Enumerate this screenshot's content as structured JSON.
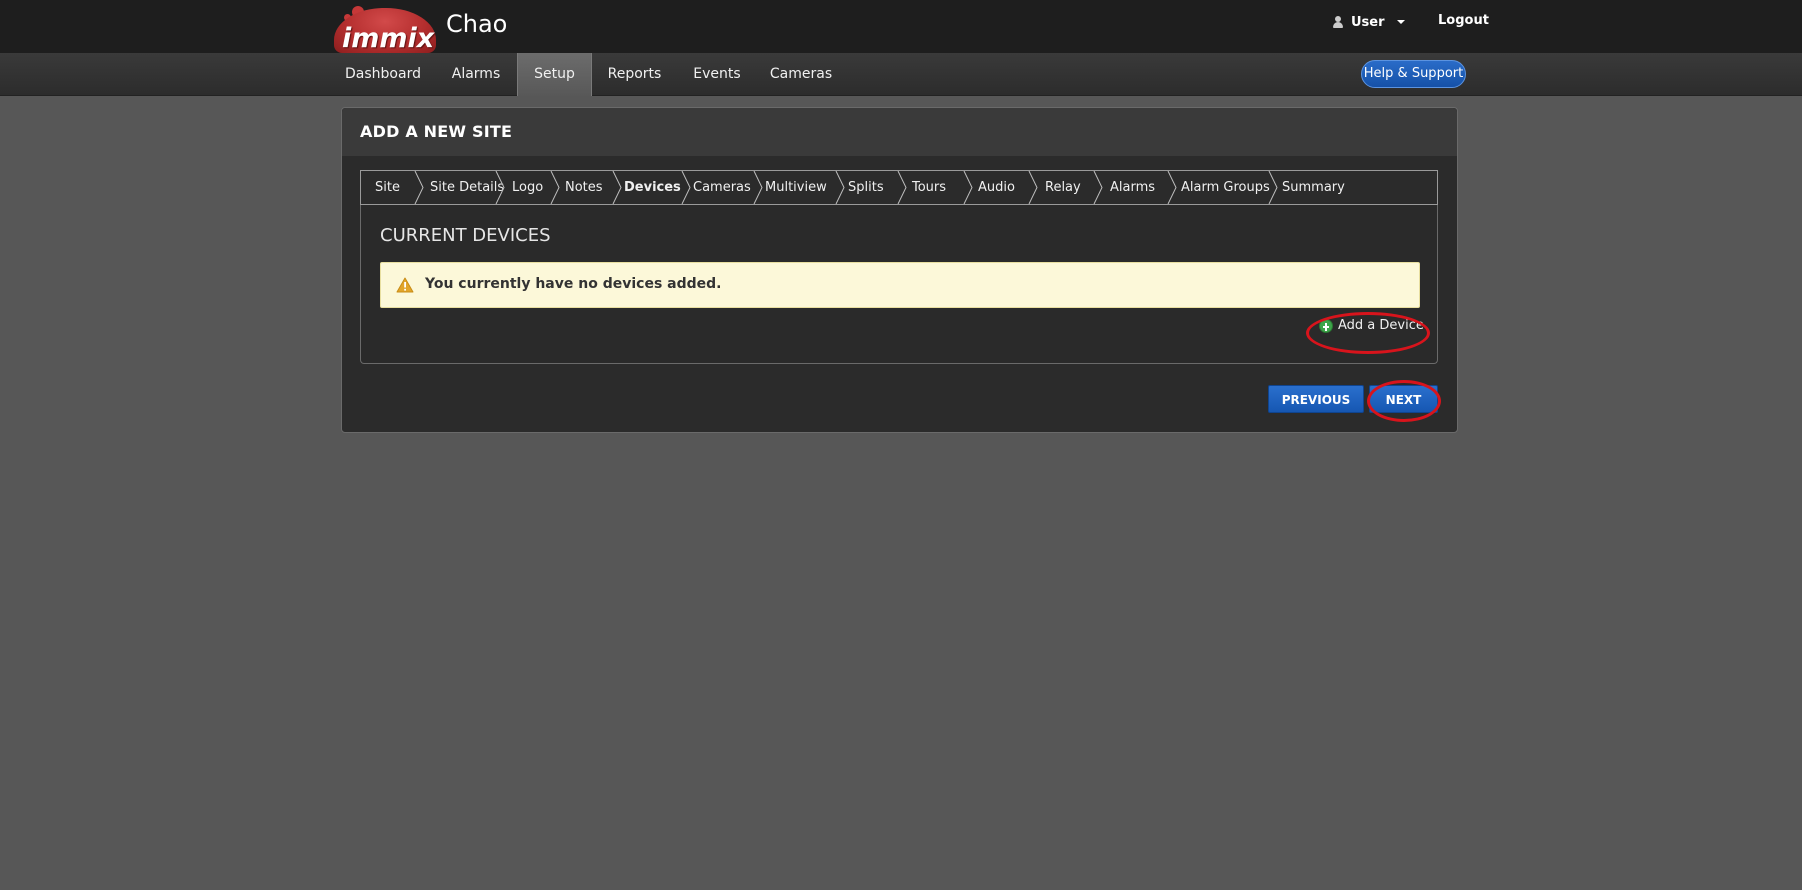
{
  "header": {
    "logo_text": "immix",
    "app_title": "Chao",
    "user_label": "User",
    "logout_label": "Logout"
  },
  "nav": {
    "items": [
      {
        "label": "Dashboard"
      },
      {
        "label": "Alarms"
      },
      {
        "label": "Setup",
        "active": true
      },
      {
        "label": "Reports"
      },
      {
        "label": "Events"
      },
      {
        "label": "Cameras"
      }
    ],
    "help_label": "Help & Support"
  },
  "panel": {
    "title": "ADD A NEW SITE",
    "steps": [
      {
        "label": "Site"
      },
      {
        "label": "Site Details"
      },
      {
        "label": "Logo"
      },
      {
        "label": "Notes"
      },
      {
        "label": "Devices",
        "active": true
      },
      {
        "label": "Cameras"
      },
      {
        "label": "Multiview"
      },
      {
        "label": "Splits"
      },
      {
        "label": "Tours"
      },
      {
        "label": "Audio"
      },
      {
        "label": "Relay"
      },
      {
        "label": "Alarms"
      },
      {
        "label": "Alarm Groups"
      },
      {
        "label": "Summary"
      }
    ],
    "section_title": "CURRENT DEVICES",
    "alert_text": "You currently have no devices added.",
    "add_device_label": "Add a Device",
    "previous_label": "PREVIOUS",
    "next_label": "NEXT"
  },
  "colors": {
    "background": "#575757",
    "topbar": "#1e1e1e",
    "accent_blue": "#1d60bd",
    "alert_bg": "#fcf8d9",
    "annotation_red": "#d8141c"
  }
}
